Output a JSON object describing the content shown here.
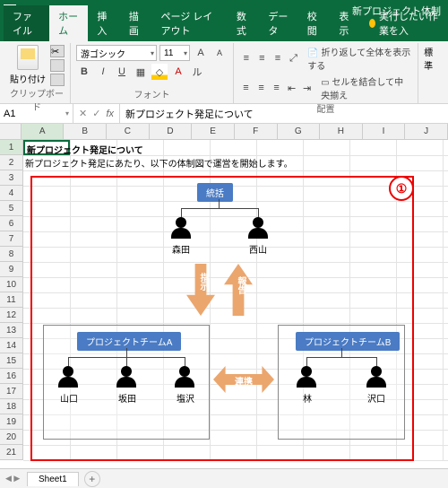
{
  "titlebar": {
    "doc_name": "新プロジェクト体制"
  },
  "tabs": {
    "file": "ファイル",
    "home": "ホーム",
    "insert": "挿入",
    "draw": "描画",
    "layout": "ページ レイアウト",
    "formulas": "数式",
    "data": "データ",
    "review": "校閲",
    "view": "表示",
    "tell": "実行したい作業を入"
  },
  "ribbon": {
    "clipboard_label": "貼り付け",
    "clipboard_group": "クリップボード",
    "font_name": "游ゴシック",
    "font_size": "11",
    "font_group": "フォント",
    "align_group": "配置",
    "wrap": "折り返して全体を表示する",
    "merge": "セルを結合して中央揃え",
    "number_group": "標準"
  },
  "namebox": "A1",
  "formula": "新プロジェクト発足について",
  "columns": [
    "A",
    "B",
    "C",
    "D",
    "E",
    "F",
    "G",
    "H",
    "I",
    "J"
  ],
  "cell_a1": "新プロジェクト発足について",
  "cell_a2": "新プロジェクト発足にあたり、以下の体制図で運営を開始します。",
  "callout": "①",
  "diagram": {
    "top_label": "統括",
    "p1": "森田",
    "p2": "西山",
    "arrow_down": "指示",
    "arrow_up": "報告",
    "arrow_dbl": "連携",
    "teamA": "プロジェクトチームA",
    "teamB": "プロジェクトチームB",
    "a1": "山口",
    "a2": "坂田",
    "a3": "塩沢",
    "b1": "林",
    "b2": "沢口"
  },
  "sheet": {
    "tab1": "Sheet1"
  }
}
